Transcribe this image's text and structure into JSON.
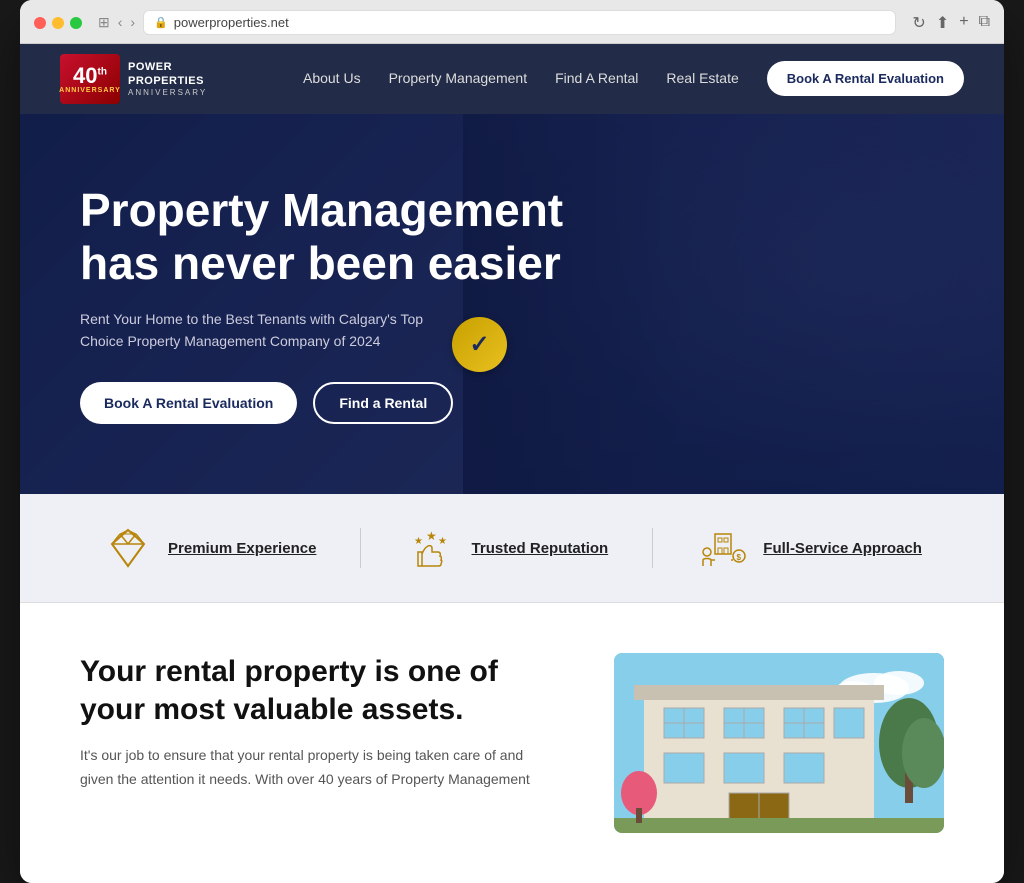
{
  "browser": {
    "url": "powerproperties.net",
    "reload_icon": "↻"
  },
  "navbar": {
    "logo": {
      "anniversary_number": "40",
      "superscript": "th",
      "company_line1": "POWER",
      "company_line2": "PROPERTIES",
      "anniversary_label": "ANNIVERSARY"
    },
    "nav_links": [
      {
        "label": "About Us",
        "href": "#"
      },
      {
        "label": "Property Management",
        "href": "#"
      },
      {
        "label": "Find A Rental",
        "href": "#"
      },
      {
        "label": "Real Estate",
        "href": "#"
      }
    ],
    "cta_button": "Book A Rental Evaluation"
  },
  "hero": {
    "title_line1": "Property Management",
    "title_line2": "has never been easier",
    "subtitle": "Rent Your Home to the Best Tenants with Calgary's Top Choice Property Management Company of 2024",
    "badge_icon": "✓",
    "button_primary": "Book A Rental Evaluation",
    "button_secondary": "Find a Rental"
  },
  "features": [
    {
      "icon_name": "diamond-icon",
      "icon_unicode": "💎",
      "label": "Premium Experience"
    },
    {
      "icon_name": "thumbs-up-stars-icon",
      "icon_unicode": "👍",
      "label": "Trusted Reputation"
    },
    {
      "icon_name": "full-service-icon",
      "icon_unicode": "🏢",
      "label": "Full-Service Approach"
    }
  ],
  "content": {
    "title": "Your rental property is one of your most valuable assets.",
    "body": "It's our job to ensure that your rental property is being taken care of and given the attention it needs. With over 40 years of Property Management"
  }
}
